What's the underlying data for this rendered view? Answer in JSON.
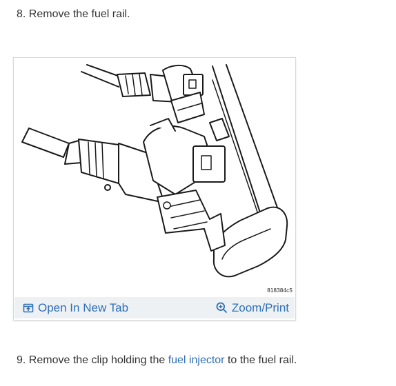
{
  "colors": {
    "link": "#2f6fb6",
    "text": "#333333",
    "toolbar_bg": "#edf1f4"
  },
  "steps": {
    "step8": {
      "text": "8. Remove the fuel rail."
    },
    "step9": {
      "prefix": "9. Remove the clip holding the ",
      "link": "fuel injector",
      "suffix": " to the fuel rail."
    }
  },
  "figure": {
    "code": "818384c5",
    "open_tab_label": "Open In New Tab",
    "open_tab_icon": "open-new-tab-icon",
    "zoom_label": "Zoom/Print",
    "zoom_icon": "zoom-in-icon"
  }
}
